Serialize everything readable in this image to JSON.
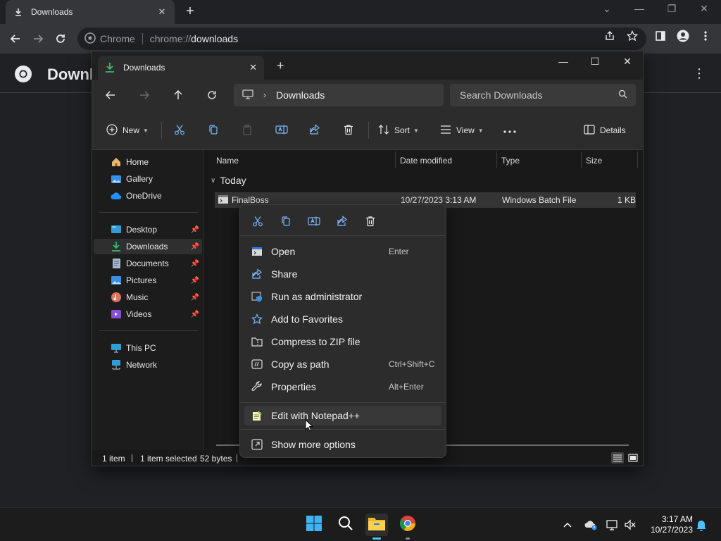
{
  "chrome": {
    "tab_title": "Downloads",
    "omnibox_chip": "Chrome",
    "url_scheme": "chrome://",
    "url_host": "downloads",
    "page_title": "Downl"
  },
  "explorer": {
    "tab_title": "Downloads",
    "breadcrumb": "Downloads",
    "search_placeholder": "Search Downloads",
    "cmd": {
      "new_label": "New",
      "sort_label": "Sort",
      "view_label": "View",
      "details_label": "Details"
    },
    "nav_pane": {
      "quick": [
        "Home",
        "Gallery",
        "OneDrive"
      ],
      "pinned": [
        "Desktop",
        "Downloads",
        "Documents",
        "Pictures",
        "Music",
        "Videos"
      ],
      "system": [
        "This PC",
        "Network"
      ]
    },
    "columns": [
      "Name",
      "Date modified",
      "Type",
      "Size"
    ],
    "group": "Today",
    "file": {
      "name": "FinalBoss",
      "date": "10/27/2023 3:13 AM",
      "type": "Windows Batch File",
      "size": "1 KB"
    },
    "status": {
      "items": "1 item",
      "selected": "1 item selected",
      "size": "52 bytes"
    }
  },
  "context_menu": {
    "items": [
      {
        "label": "Open",
        "shortcut": "Enter"
      },
      {
        "label": "Share",
        "shortcut": ""
      },
      {
        "label": "Run as administrator",
        "shortcut": ""
      },
      {
        "label": "Add to Favorites",
        "shortcut": ""
      },
      {
        "label": "Compress to ZIP file",
        "shortcut": ""
      },
      {
        "label": "Copy as path",
        "shortcut": "Ctrl+Shift+C"
      },
      {
        "label": "Properties",
        "shortcut": "Alt+Enter"
      },
      {
        "label": "Edit with Notepad++",
        "shortcut": ""
      },
      {
        "label": "Show more options",
        "shortcut": ""
      }
    ]
  },
  "taskbar": {
    "time": "3:17 AM",
    "date": "10/27/2023"
  },
  "colors": {
    "accent": "#4cc2ff",
    "chrome_bg": "#202124",
    "explorer_bg": "#191919",
    "menu_bg": "#2c2c2c"
  }
}
